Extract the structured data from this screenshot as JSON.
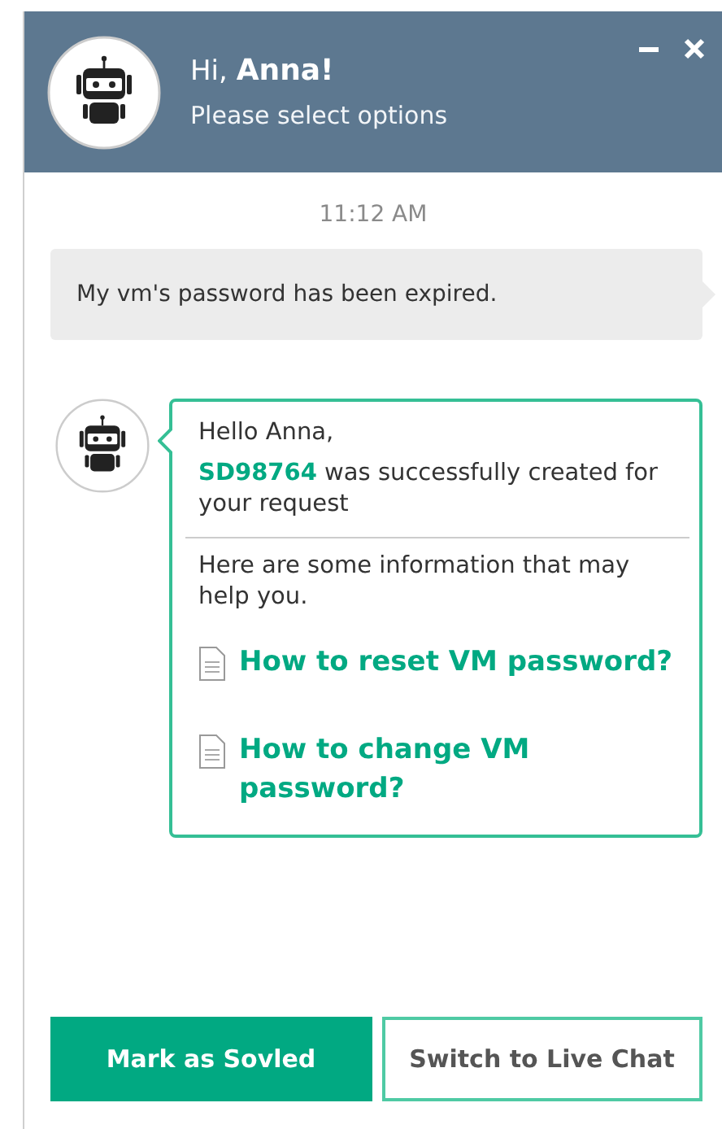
{
  "header": {
    "greeting": "Hi, **Anna!**",
    "subtitle": "Please select options",
    "controls": [
      {
        "kind": "minimize"
      },
      {
        "kind": "close"
      }
    ]
  },
  "timestamp": "11:12 AM",
  "messages": [
    {
      "kind": "user",
      "text": "My vm's password has been expired."
    },
    {
      "kind": "bot",
      "greeting": "Hello Anna,",
      "status": "**SD98764** was successfully created for your request",
      "info": "Here are some information that may help you.",
      "links": [
        "How to reset VM password?",
        "How to change VM password?"
      ]
    }
  ],
  "actions": [
    {
      "kind": "primary",
      "label": "Mark as Sovled"
    },
    {
      "kind": "secondary",
      "label": "Switch to Live Chat"
    }
  ]
}
